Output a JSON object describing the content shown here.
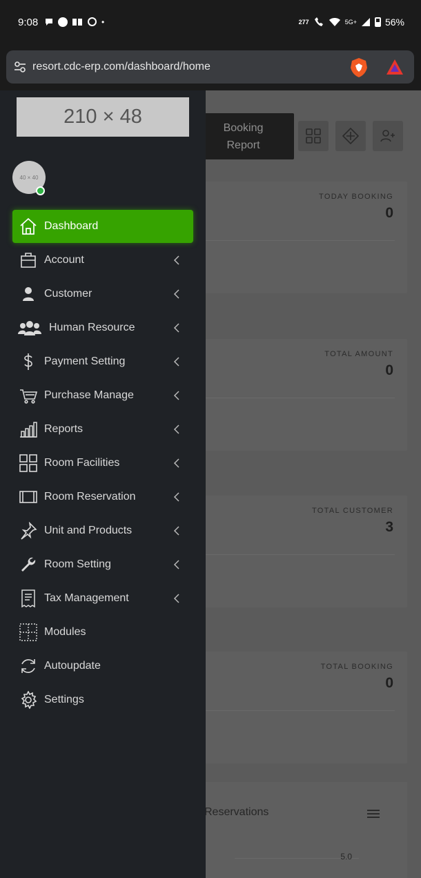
{
  "status_bar": {
    "time": "9:08",
    "network_label": "5G+",
    "battery": "56%",
    "data_rate": "277"
  },
  "browser": {
    "url": "resort.cdc-erp.com/dashboard/home"
  },
  "background": {
    "booking_report_line1": "Booking",
    "booking_report_line2": "Report",
    "cards": [
      {
        "label": "TODAY BOOKING",
        "value": "0"
      },
      {
        "label": "TOTAL AMOUNT",
        "value": "0"
      },
      {
        "label": "TOTAL CUSTOMER",
        "value": "3"
      },
      {
        "label": "TOTAL BOOKING",
        "value": "0"
      }
    ],
    "reservations_title": "Reservations",
    "reservations_tick": "5.0"
  },
  "sidebar": {
    "logo_text": "210 × 48",
    "avatar_text": "40 × 40",
    "items": [
      {
        "label": "Dashboard",
        "icon": "home-icon",
        "active": true,
        "has_submenu": false
      },
      {
        "label": "Account",
        "icon": "briefcase-icon",
        "active": false,
        "has_submenu": true
      },
      {
        "label": "Customer",
        "icon": "user-icon",
        "active": false,
        "has_submenu": true
      },
      {
        "label": "Human Resource",
        "icon": "users-icon",
        "active": false,
        "has_submenu": true
      },
      {
        "label": "Payment Setting",
        "icon": "dollar-icon",
        "active": false,
        "has_submenu": true
      },
      {
        "label": "Purchase Manage",
        "icon": "cart-icon",
        "active": false,
        "has_submenu": true
      },
      {
        "label": "Reports",
        "icon": "bar-chart-icon",
        "active": false,
        "has_submenu": true
      },
      {
        "label": "Room Facilities",
        "icon": "grid-icon",
        "active": false,
        "has_submenu": true
      },
      {
        "label": "Room Reservation",
        "icon": "reservation-icon",
        "active": false,
        "has_submenu": true
      },
      {
        "label": "Unit and Products",
        "icon": "pin-icon",
        "active": false,
        "has_submenu": true
      },
      {
        "label": "Room Setting",
        "icon": "wrench-icon",
        "active": false,
        "has_submenu": true
      },
      {
        "label": "Tax Management",
        "icon": "receipt-icon",
        "active": false,
        "has_submenu": true
      },
      {
        "label": "Modules",
        "icon": "modules-icon",
        "active": false,
        "has_submenu": false
      },
      {
        "label": "Autoupdate",
        "icon": "sync-icon",
        "active": false,
        "has_submenu": false
      },
      {
        "label": "Settings",
        "icon": "gear-icon",
        "active": false,
        "has_submenu": false
      }
    ]
  },
  "colors": {
    "active": "#36a300",
    "sidebar_bg": "#1f2226",
    "online": "#2fb344"
  }
}
